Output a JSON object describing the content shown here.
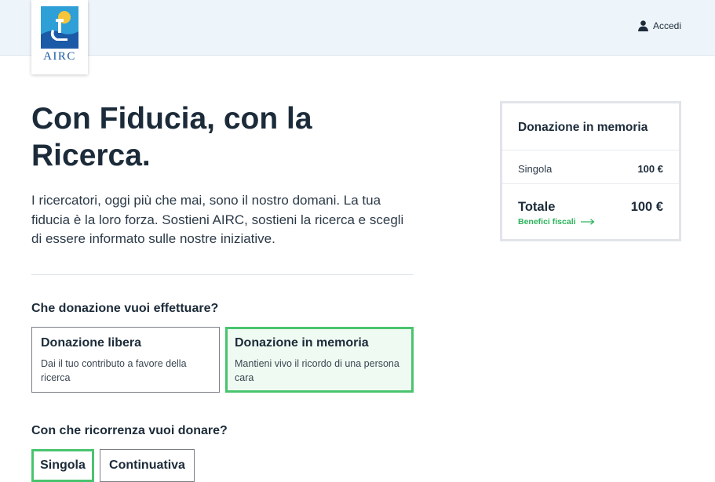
{
  "brand": {
    "logo_text": "AIRC",
    "icon": "airc-logo-icon"
  },
  "header": {
    "login_label": "Accedi",
    "login_icon": "user-icon"
  },
  "hero": {
    "title": "Con Fiducia, con la Ricerca.",
    "intro": "I ricercatori, oggi più che mai, sono il nostro domani. La tua fiducia è la loro forza. Sostieni AIRC, sostieni la ricerca e scegli di essere informato sulle nostre iniziative."
  },
  "donation_type": {
    "question": "Che donazione vuoi effettuare?",
    "options": [
      {
        "title": "Donazione libera",
        "desc": "Dai il tuo contributo a favore della ricerca",
        "selected": false
      },
      {
        "title": "Donazione in memoria",
        "desc": "Mantieni vivo il ricordo di una persona cara",
        "selected": true
      }
    ]
  },
  "recurrence": {
    "question": "Con che ricorrenza vuoi donare?",
    "options": [
      {
        "label": "Singola",
        "selected": true
      },
      {
        "label": "Continuativa",
        "selected": false
      }
    ]
  },
  "summary": {
    "title": "Donazione in memoria",
    "row_label": "Singola",
    "row_value": "100 €",
    "total_label": "Totale",
    "total_value": "100 €",
    "benefits_label": "Benefici fiscali",
    "benefits_icon": "arrow-right-icon"
  },
  "colors": {
    "accent_green": "#49c46e",
    "selected_bg": "#effbf2",
    "text_dark": "#1c2b39",
    "topbar_bg": "#eef5fa"
  }
}
